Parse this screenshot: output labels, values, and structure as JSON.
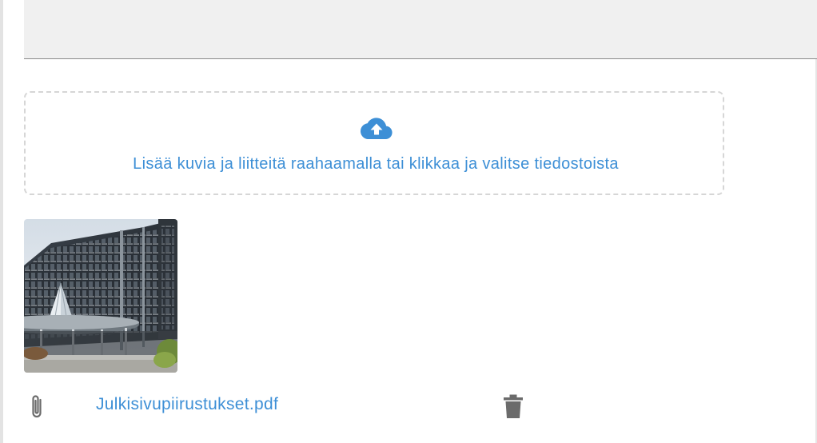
{
  "text_area": {
    "value": ""
  },
  "upload": {
    "prompt": "Lisää kuvia ja liitteitä raahaamalla tai klikkaa ja valitse tiedostoista",
    "icon": "cloud-upload-icon",
    "accent_color": "#3d8fd6"
  },
  "attachments": [
    {
      "file_name": "Julkisivupiirustukset.pdf",
      "file_icon": "paperclip-icon",
      "action_icon": "trash-icon"
    }
  ]
}
